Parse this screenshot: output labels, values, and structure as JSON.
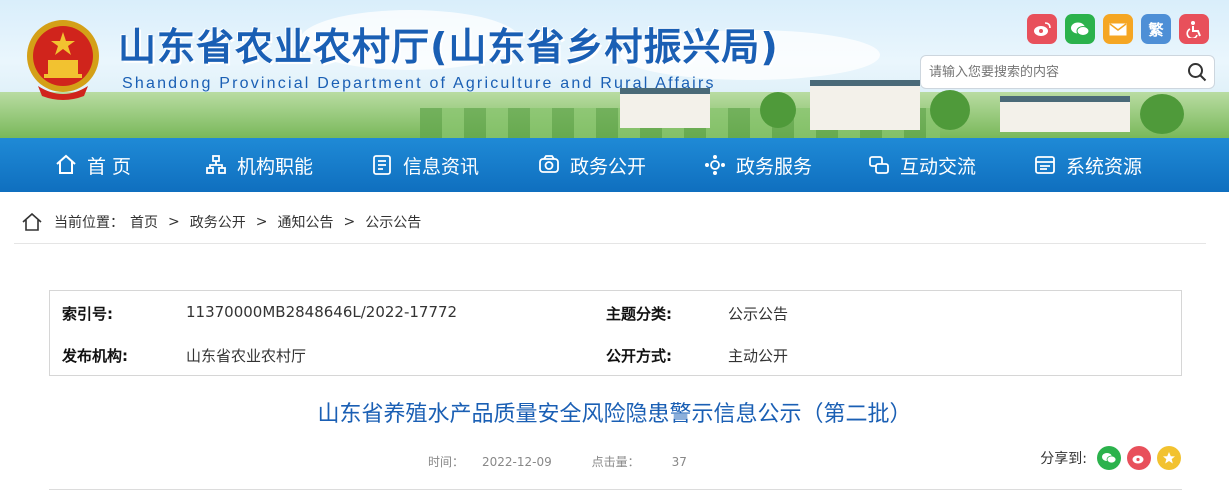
{
  "header": {
    "site_title": "山东省农业农村厅(山东省乡村振兴局)",
    "site_subtitle": "Shandong Provincial Department of Agriculture and Rural Affairs",
    "top_icons": [
      {
        "name": "weibo-icon",
        "color": "#e8505b"
      },
      {
        "name": "wechat-icon",
        "color": "#2bb24c"
      },
      {
        "name": "mail-icon",
        "color": "#f5a623"
      },
      {
        "name": "traditional-chinese-toggle",
        "label": "繁",
        "color": "#4e8fd6"
      },
      {
        "name": "accessibility-icon",
        "color": "#e8505b"
      }
    ],
    "search_placeholder": "请输入您要搜索的内容"
  },
  "nav": {
    "items": [
      {
        "label": "首 页",
        "icon": "home-icon"
      },
      {
        "label": "机构职能",
        "icon": "org-icon"
      },
      {
        "label": "信息资讯",
        "icon": "document-icon"
      },
      {
        "label": "政务公开",
        "icon": "public-affairs-icon"
      },
      {
        "label": "政务服务",
        "icon": "service-icon"
      },
      {
        "label": "互动交流",
        "icon": "interaction-icon"
      },
      {
        "label": "系统资源",
        "icon": "resources-icon"
      }
    ]
  },
  "breadcrumb": {
    "prefix": "当前位置：",
    "items": [
      "首页",
      "政务公开",
      "通知公告",
      "公示公告"
    ],
    "separator": ">"
  },
  "info": {
    "index_label": "索引号:",
    "index_value": "11370000MB2848646L/2022-17772",
    "topic_label": "主题分类:",
    "topic_value": "公示公告",
    "publisher_label": "发布机构:",
    "publisher_value": "山东省农业农村厅",
    "method_label": "公开方式:",
    "method_value": "主动公开"
  },
  "article": {
    "title": "山东省养殖水产品质量安全风险隐患警示信息公示（第二批）",
    "date_label": "时间：",
    "date_value": "2022-12-09",
    "clicks_label": "点击量：",
    "clicks_value": "37"
  },
  "share": {
    "label": "分享到:",
    "icons": [
      "wechat-icon",
      "weibo-icon",
      "qzone-icon"
    ]
  },
  "colors": {
    "brand_blue": "#1a5fb4",
    "nav_bg": "#1479c9"
  }
}
